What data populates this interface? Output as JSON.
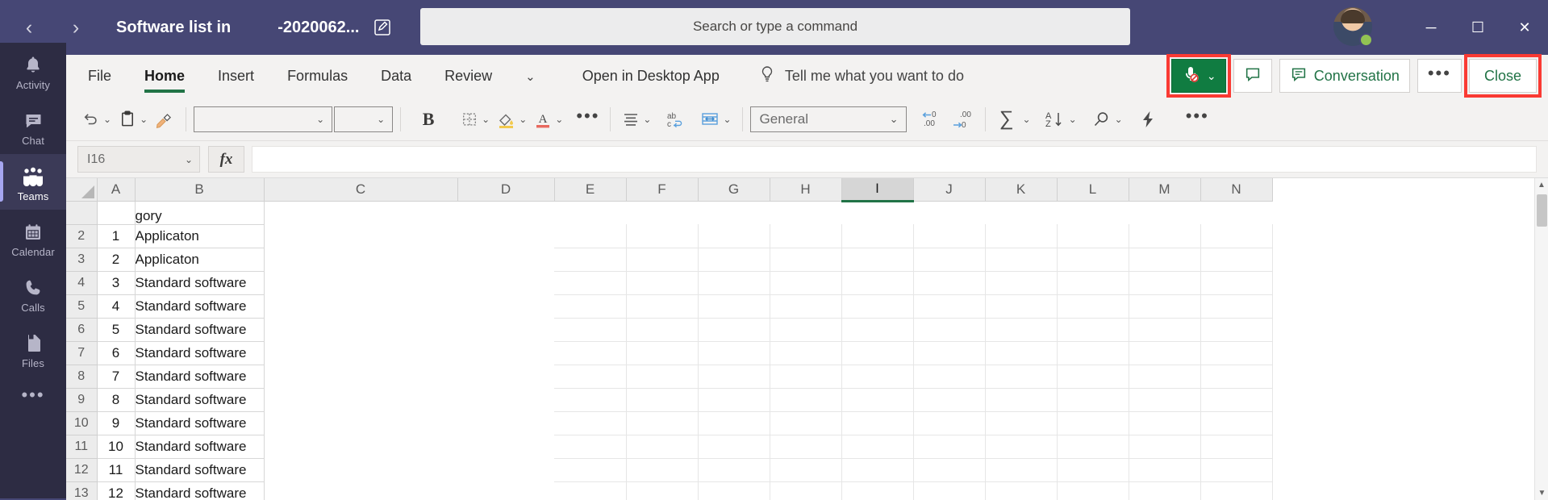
{
  "titlebar": {
    "back_icon": "‹",
    "forward_icon": "›",
    "title": "Software list in",
    "subtitle": "-2020062...",
    "edit_icon": "edit-pencil-icon",
    "search_placeholder": "Search or type a command",
    "minimize": "─",
    "maximize": "☐",
    "close": "✕",
    "brand_color": "#464775"
  },
  "rail": {
    "items": [
      {
        "label": "Activity",
        "icon": "bell-icon",
        "active": false
      },
      {
        "label": "Chat",
        "icon": "chat-bubble-icon",
        "active": false
      },
      {
        "label": "Teams",
        "icon": "teams-people-icon",
        "active": true
      },
      {
        "label": "Calendar",
        "icon": "calendar-icon",
        "active": false
      },
      {
        "label": "Calls",
        "icon": "phone-icon",
        "active": false
      },
      {
        "label": "Files",
        "icon": "file-icon",
        "active": false
      }
    ],
    "more": "•••",
    "bg_color": "#2d2c43",
    "active_bg": "#3b3a57"
  },
  "ribbon": {
    "tabs": [
      {
        "label": "File",
        "active": false
      },
      {
        "label": "Home",
        "active": true
      },
      {
        "label": "Insert",
        "active": false
      },
      {
        "label": "Formulas",
        "active": false
      },
      {
        "label": "Data",
        "active": false
      },
      {
        "label": "Review",
        "active": false
      }
    ],
    "overflow_caret": "⌄",
    "open_in_desktop": "Open in Desktop App",
    "tell_me": "Tell me what you want to do",
    "tell_me_icon": "lightbulb-icon",
    "mic_button": {
      "name": "mic-muted-button",
      "caret": "⌄",
      "color": "#107c41",
      "highlighted": true
    },
    "comment_button": {
      "name": "comment-icon",
      "label": ""
    },
    "conversation_button": {
      "label": "Conversation",
      "icon": "conversation-icon"
    },
    "more_button": {
      "label": "•••"
    },
    "close_button": {
      "label": "Close",
      "highlighted": true
    },
    "highlight_color": "#fa3a33",
    "accent_color": "#217346"
  },
  "toolbar": {
    "undo": "undo-icon",
    "paste": "paste-icon",
    "format_painter": "format-painter-icon",
    "font_name": "",
    "font_size": "",
    "bold": "B",
    "borders": "borders-icon",
    "fill_color": "fill-color-icon",
    "font_color": "font-color-icon",
    "font_more": "•••",
    "align": "align-icon",
    "wrap_text": "wrap-text-icon",
    "merge": "merge-cells-icon",
    "number_format": "General",
    "decrease_decimal": "←0\n.00",
    "increase_decimal": ".00\n→0",
    "autosum": "∑",
    "sort_filter": "sort-filter-icon",
    "find": "find-icon",
    "ideas": "ideas-icon",
    "more": "•••",
    "caret": "⌄"
  },
  "formulabar": {
    "name_box_value": "I16",
    "name_box_caret": "⌄",
    "fx_label": "fx",
    "formula_value": ""
  },
  "grid": {
    "columns": [
      "A",
      "B",
      "C",
      "D",
      "E",
      "F",
      "G",
      "H",
      "I",
      "J",
      "K",
      "L",
      "M",
      "N"
    ],
    "selected_column": "I",
    "clipped_row1_text": "gory",
    "rows": [
      {
        "header": "2",
        "a": "1",
        "b": "Applicaton"
      },
      {
        "header": "3",
        "a": "2",
        "b": "Applicaton"
      },
      {
        "header": "4",
        "a": "3",
        "b": "Standard software"
      },
      {
        "header": "5",
        "a": "4",
        "b": "Standard software"
      },
      {
        "header": "6",
        "a": "5",
        "b": "Standard software"
      },
      {
        "header": "7",
        "a": "6",
        "b": "Standard software"
      },
      {
        "header": "8",
        "a": "7",
        "b": "Standard software"
      },
      {
        "header": "9",
        "a": "8",
        "b": "Standard software"
      },
      {
        "header": "10",
        "a": "9",
        "b": "Standard software"
      },
      {
        "header": "11",
        "a": "10",
        "b": "Standard software"
      },
      {
        "header": "12",
        "a": "11",
        "b": "Standard software"
      },
      {
        "header": "13",
        "a": "12",
        "b": "Standard software"
      }
    ],
    "scroll_up_icon": "▲",
    "scroll_down_icon": "▼"
  }
}
